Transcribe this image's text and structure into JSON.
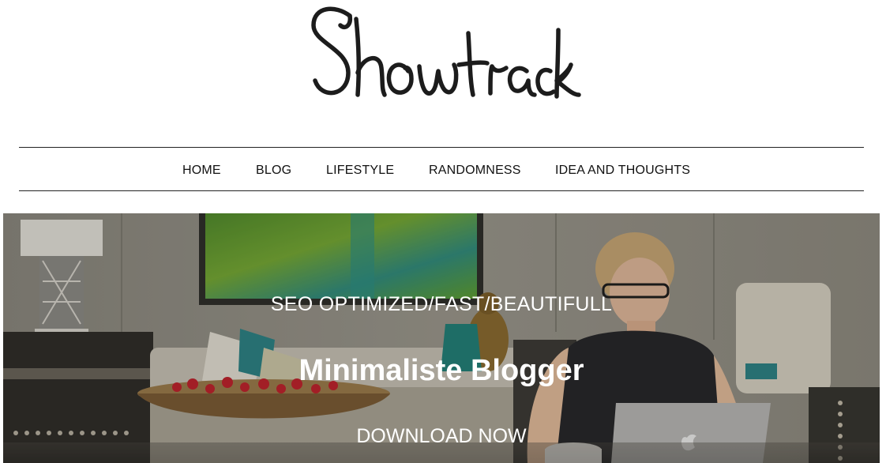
{
  "brand": {
    "logo_text": "Showtrack"
  },
  "nav": {
    "items": [
      {
        "label": "HOME"
      },
      {
        "label": "BLOG"
      },
      {
        "label": "LIFESTYLE"
      },
      {
        "label": "RANDOMNESS"
      },
      {
        "label": "IDEA AND THOUGHTS"
      }
    ]
  },
  "hero": {
    "tagline": "SEO OPTIMIZED/FAST/BEAUTIFULL",
    "title": "Minimaliste Blogger",
    "cta_label": "DOWNLOAD NOW"
  },
  "colors": {
    "text": "#111111",
    "hero_text": "#ffffff",
    "nav_border": "#222222"
  }
}
